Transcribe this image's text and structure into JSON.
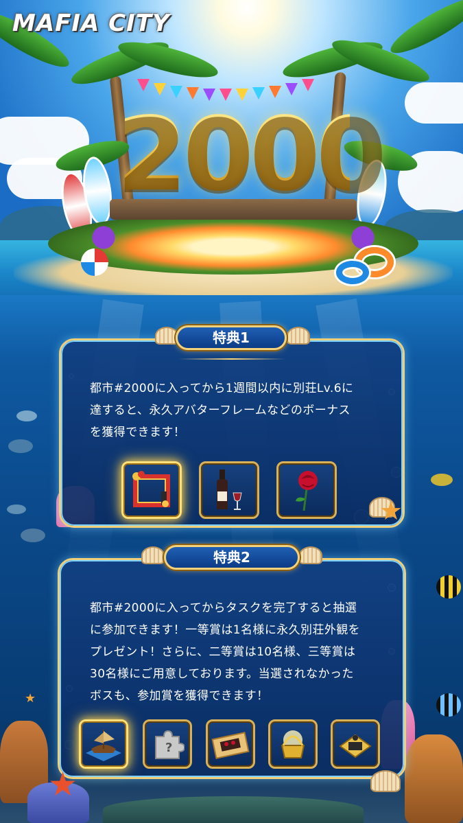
{
  "brand": {
    "logo_text": "MAFIA CITY"
  },
  "hero": {
    "number": "2000"
  },
  "benefit1": {
    "title": "特典1",
    "text": "都市#2000に入ってから1週間以内に別荘Lv.6に\n達すると、永久アバターフレームなどのボーナス\nを獲得できます！",
    "rewards": [
      {
        "icon": "avatar-frame-icon",
        "highlighted": true
      },
      {
        "icon": "wine-bottle-icon",
        "highlighted": false
      },
      {
        "icon": "red-rose-icon",
        "highlighted": false
      }
    ]
  },
  "benefit2": {
    "title": "特典2",
    "text": "都市#2000に入ってからタスクを完了すると抽選\nに参加できます！一等賞は1名様に永久別荘外観を\nプレゼント！さらに、二等賞は10名様、三等賞は\n30名様にご用意しております。当選されなかった\nボスも、参加賞を獲得できます！",
    "rewards": [
      {
        "icon": "villa-appearance-icon",
        "highlighted": true
      },
      {
        "icon": "puzzle-piece-icon",
        "highlighted": false
      },
      {
        "icon": "gift-box-icon",
        "highlighted": false
      },
      {
        "icon": "glowing-chest-icon",
        "highlighted": false
      },
      {
        "icon": "gold-ticket-icon",
        "highlighted": false
      }
    ]
  },
  "colors": {
    "panel_border": "#f0cf7a",
    "accent_glow": "#ffd34d",
    "water": "#0b4a8c"
  }
}
